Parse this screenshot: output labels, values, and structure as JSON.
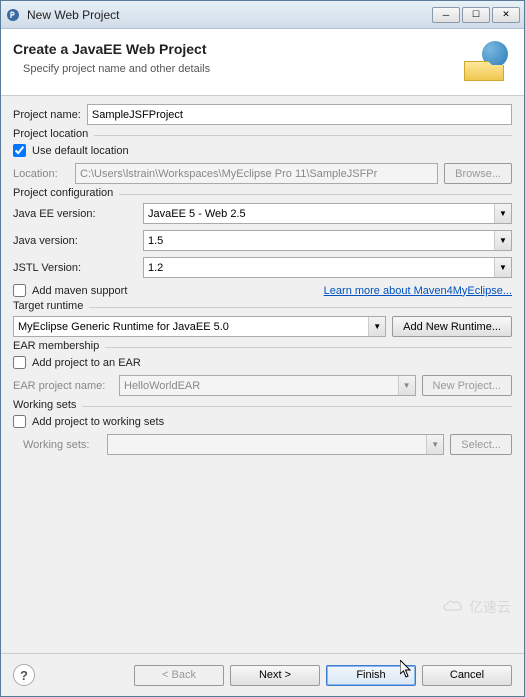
{
  "window": {
    "title": "New Web Project",
    "min": "─",
    "max": "☐",
    "close": "✕"
  },
  "header": {
    "title": "Create a JavaEE Web Project",
    "subtitle": "Specify project name and other details"
  },
  "projectName": {
    "label": "Project name:",
    "value": "SampleJSFProject"
  },
  "projectLocation": {
    "group": "Project location",
    "useDefault": "Use default location",
    "locationLabel": "Location:",
    "locationValue": "C:\\Users\\lstrain\\Workspaces\\MyEclipse Pro 11\\SampleJSFPr",
    "browse": "Browse..."
  },
  "projectConfig": {
    "group": "Project configuration",
    "javaEEVerLabel": "Java EE version:",
    "javaEEVerValue": "JavaEE 5 - Web 2.5",
    "javaVerLabel": "Java version:",
    "javaVerValue": "1.5",
    "jstlVerLabel": "JSTL Version:",
    "jstlVerValue": "1.2",
    "addMaven": "Add maven support",
    "learnMore": "Learn more about Maven4MyEclipse..."
  },
  "targetRuntime": {
    "group": "Target runtime",
    "value": "MyEclipse Generic Runtime for JavaEE 5.0",
    "addNew": "Add New Runtime..."
  },
  "ear": {
    "group": "EAR membership",
    "addToEar": "Add project to an EAR",
    "nameLabel": "EAR project name:",
    "nameValue": "HelloWorldEAR",
    "newProject": "New Project..."
  },
  "workingSets": {
    "group": "Working sets",
    "add": "Add project to working sets",
    "label": "Working sets:",
    "select": "Select..."
  },
  "buttons": {
    "back": "< Back",
    "next": "Next >",
    "finish": "Finish",
    "cancel": "Cancel"
  },
  "watermark": "亿速云"
}
